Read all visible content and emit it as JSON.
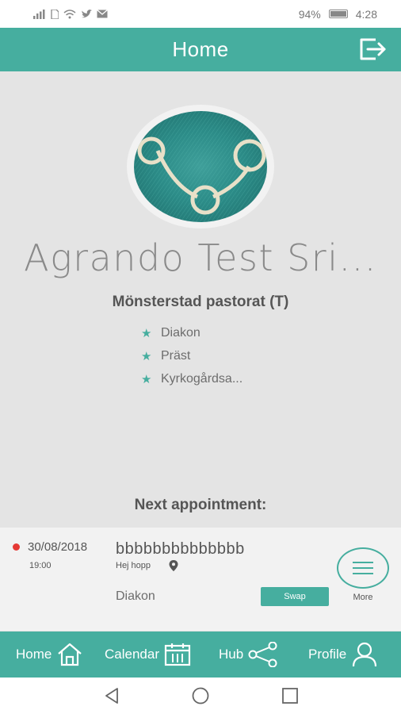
{
  "status_bar": {
    "battery_percent": "94%",
    "time": "4:28",
    "icons": [
      "signal-icon",
      "sim-icon",
      "wifi-icon",
      "twitter-icon",
      "mail-icon"
    ]
  },
  "header": {
    "title": "Home",
    "logout_icon": "logout-icon"
  },
  "profile": {
    "name": "Agrando Test Sri...",
    "organization": "Mönsterstad pastorat (T)",
    "roles": [
      "Diakon",
      "Präst",
      "Kyrkogårdsa..."
    ]
  },
  "next_appointment": {
    "heading": "Next appointment:",
    "date": "30/08/2018",
    "time": "19:00",
    "title": "bbbbbbbbbbbbbb",
    "description": "Hej hopp",
    "role": "Diakon",
    "swap_label": "Swap",
    "more_label": "More"
  },
  "tabs": [
    {
      "label": "Home",
      "icon": "home-icon"
    },
    {
      "label": "Calendar",
      "icon": "calendar-icon"
    },
    {
      "label": "Hub",
      "icon": "share-icon"
    },
    {
      "label": "Profile",
      "icon": "user-icon"
    }
  ],
  "colors": {
    "accent": "#46ae9f",
    "background": "#e4e4e4",
    "card": "#f2f2f2",
    "status_dot": "#e53935"
  }
}
